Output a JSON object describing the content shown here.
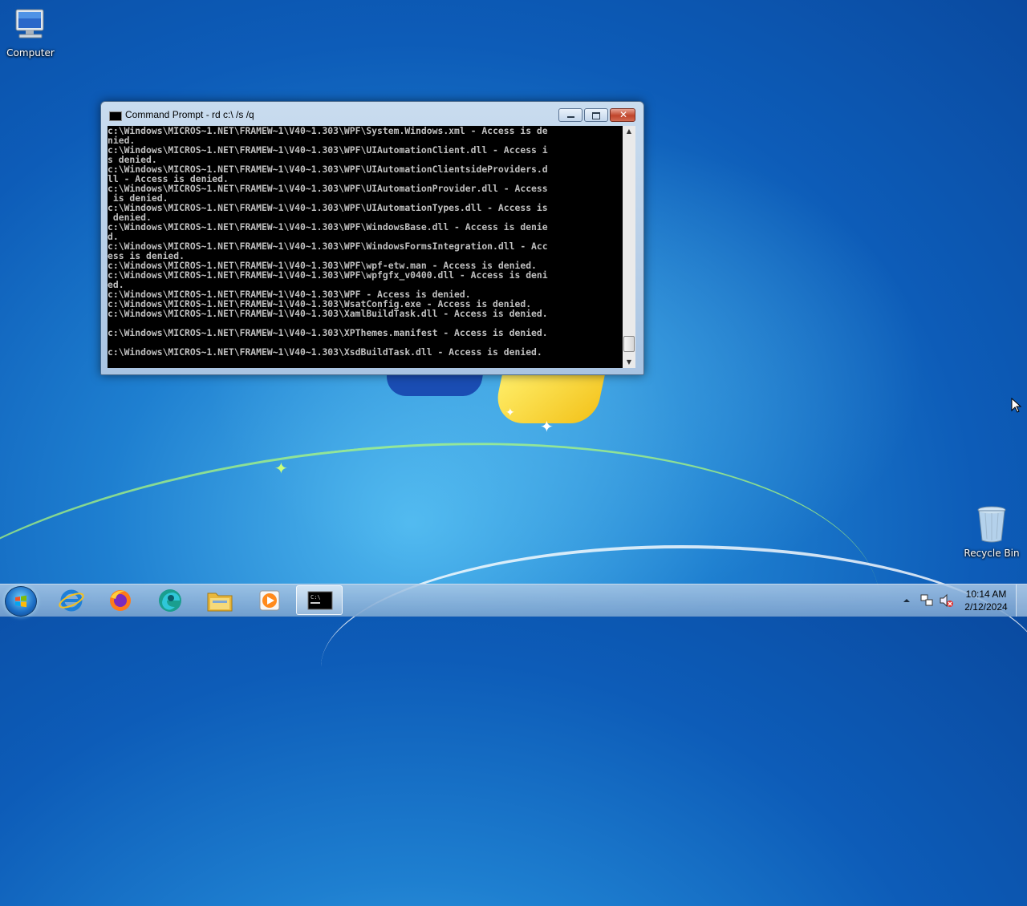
{
  "desktop": {
    "icons": [
      {
        "label": "Computer",
        "icon": "computer-icon"
      },
      {
        "label": "Recycle Bin",
        "icon": "recycle-bin-icon"
      }
    ]
  },
  "cmd_window": {
    "title": "Command Prompt - rd  c:\\ /s /q",
    "lines": [
      "c:\\Windows\\MICROS~1.NET\\FRAMEW~1\\V40~1.303\\WPF\\System.Windows.xml - Access is de",
      "nied.",
      "c:\\Windows\\MICROS~1.NET\\FRAMEW~1\\V40~1.303\\WPF\\UIAutomationClient.dll - Access i",
      "s denied.",
      "c:\\Windows\\MICROS~1.NET\\FRAMEW~1\\V40~1.303\\WPF\\UIAutomationClientsideProviders.d",
      "ll - Access is denied.",
      "c:\\Windows\\MICROS~1.NET\\FRAMEW~1\\V40~1.303\\WPF\\UIAutomationProvider.dll - Access",
      " is denied.",
      "c:\\Windows\\MICROS~1.NET\\FRAMEW~1\\V40~1.303\\WPF\\UIAutomationTypes.dll - Access is",
      " denied.",
      "c:\\Windows\\MICROS~1.NET\\FRAMEW~1\\V40~1.303\\WPF\\WindowsBase.dll - Access is denie",
      "d.",
      "c:\\Windows\\MICROS~1.NET\\FRAMEW~1\\V40~1.303\\WPF\\WindowsFormsIntegration.dll - Acc",
      "ess is denied.",
      "c:\\Windows\\MICROS~1.NET\\FRAMEW~1\\V40~1.303\\WPF\\wpf-etw.man - Access is denied.",
      "c:\\Windows\\MICROS~1.NET\\FRAMEW~1\\V40~1.303\\WPF\\wpfgfx_v0400.dll - Access is deni",
      "ed.",
      "c:\\Windows\\MICROS~1.NET\\FRAMEW~1\\V40~1.303\\WPF - Access is denied.",
      "c:\\Windows\\MICROS~1.NET\\FRAMEW~1\\V40~1.303\\WsatConfig.exe - Access is denied.",
      "c:\\Windows\\MICROS~1.NET\\FRAMEW~1\\V40~1.303\\XamlBuildTask.dll - Access is denied.",
      "",
      "c:\\Windows\\MICROS~1.NET\\FRAMEW~1\\V40~1.303\\XPThemes.manifest - Access is denied.",
      "",
      "c:\\Windows\\MICROS~1.NET\\FRAMEW~1\\V40~1.303\\XsdBuildTask.dll - Access is denied."
    ]
  },
  "taskbar": {
    "pinned": [
      {
        "name": "internet-explorer-icon"
      },
      {
        "name": "firefox-icon"
      },
      {
        "name": "edge-icon"
      },
      {
        "name": "file-explorer-icon"
      },
      {
        "name": "media-player-icon"
      },
      {
        "name": "command-prompt-icon",
        "active": true
      }
    ],
    "clock": {
      "time": "10:14 AM",
      "date": "2/12/2024"
    }
  }
}
